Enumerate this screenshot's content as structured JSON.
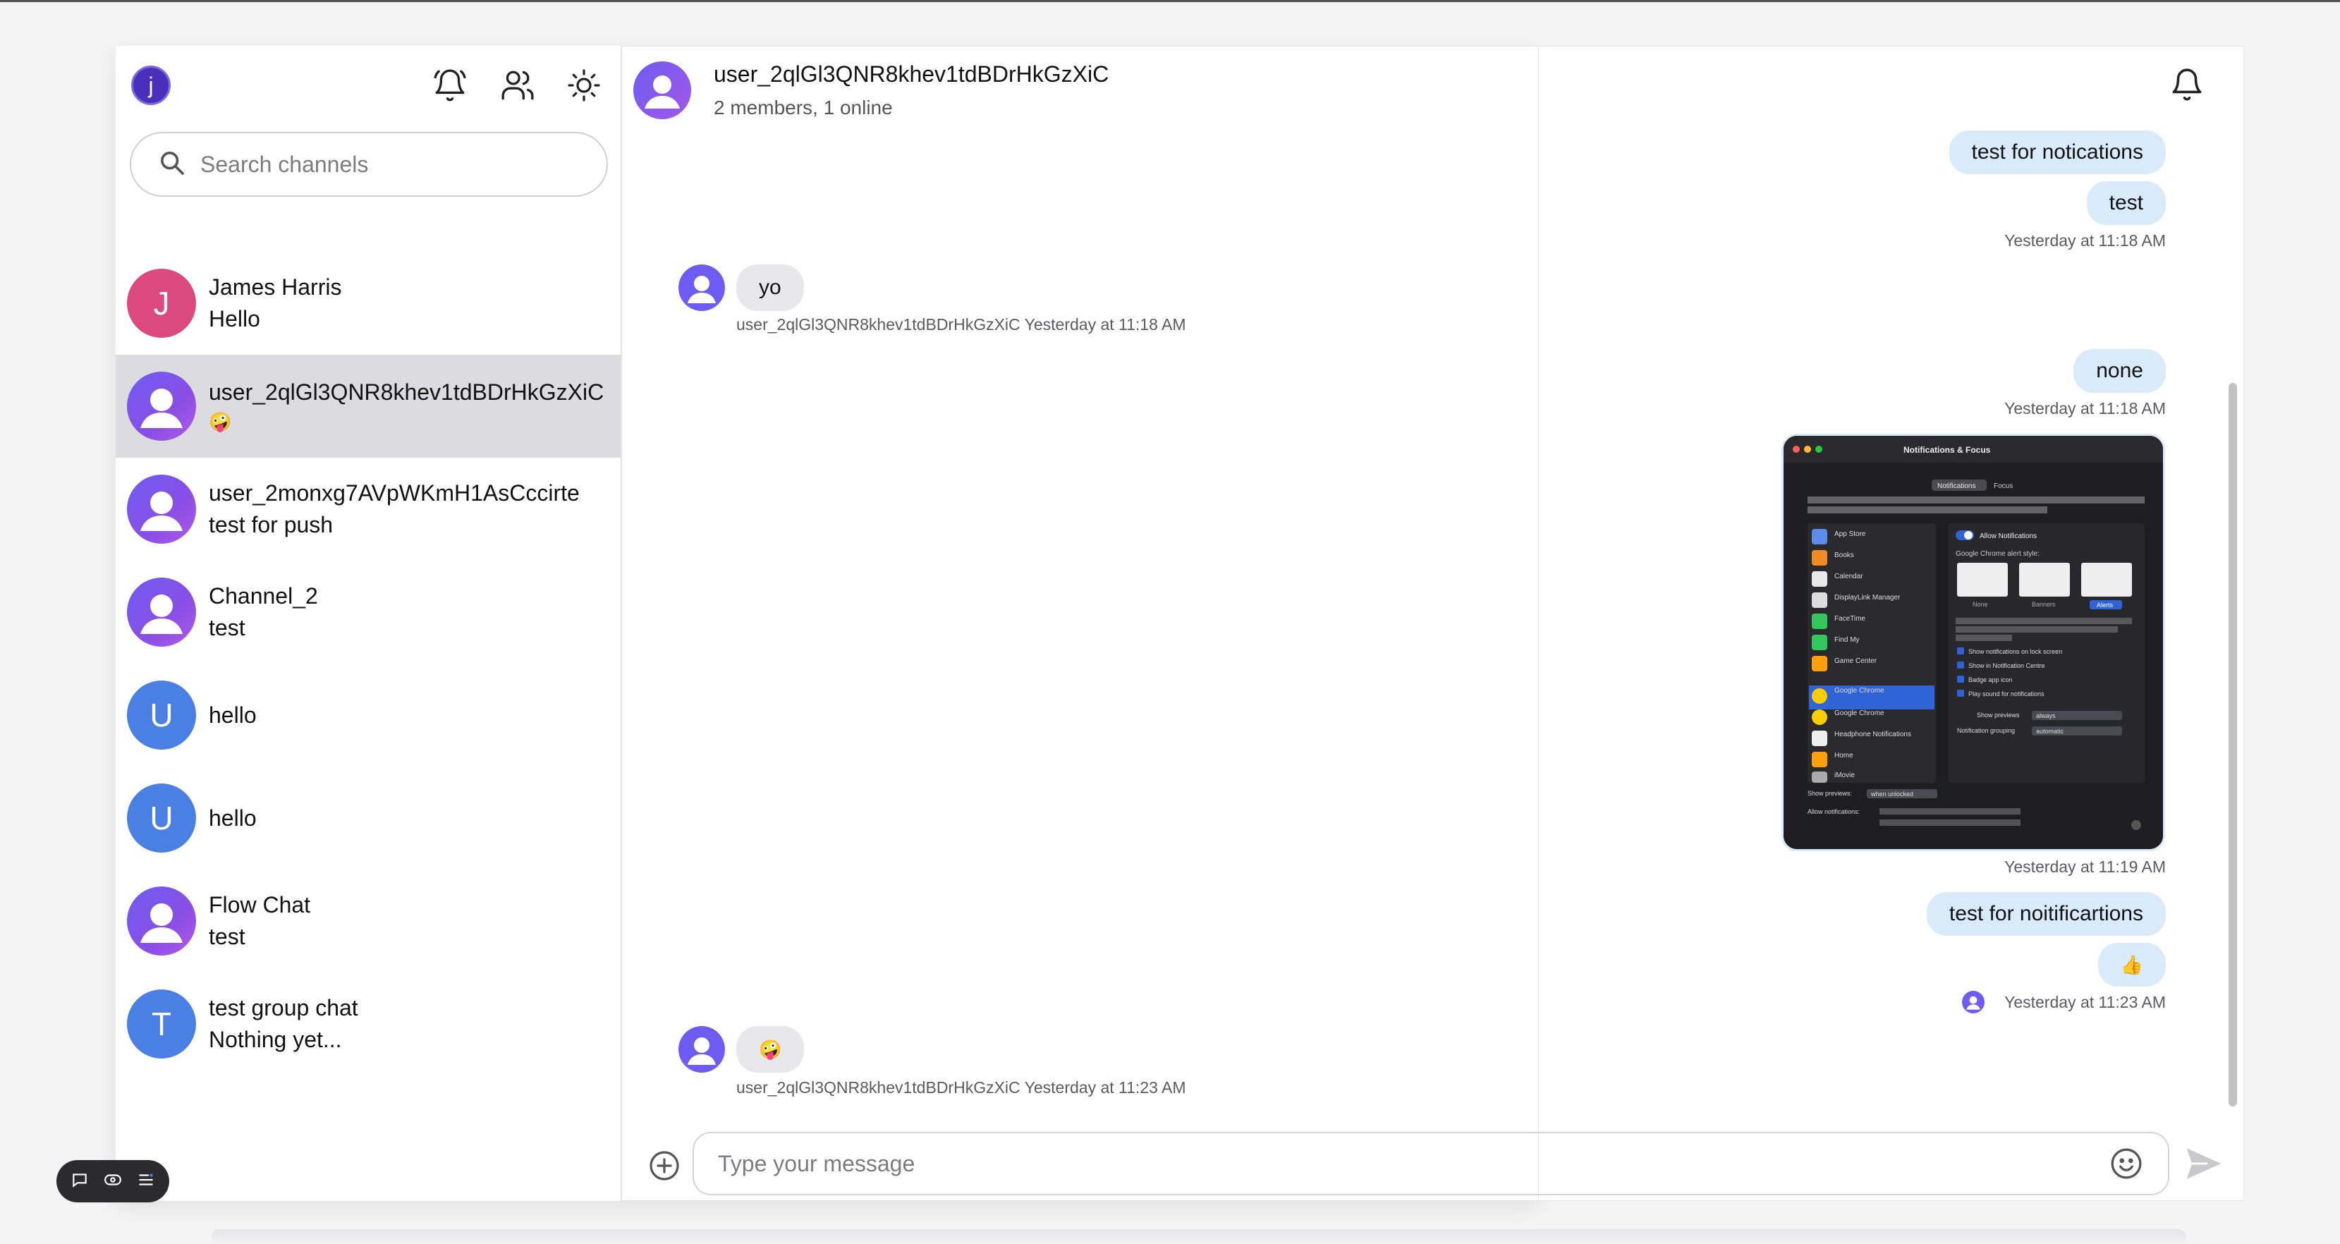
{
  "me": {
    "initial": "j"
  },
  "search": {
    "placeholder": "Search channels"
  },
  "channels": [
    {
      "name": "James Harris",
      "preview": "Hello",
      "avatar_initial": "J"
    },
    {
      "name": "user_2qlGl3QNR8khev1tdBDrHkGzXiC",
      "preview": "🤪",
      "active": true
    },
    {
      "name": "user_2monxg7AVpWKmH1AsCccirte",
      "preview": "test for push"
    },
    {
      "name": "Channel_2",
      "preview": "test"
    },
    {
      "name": "",
      "preview": "hello",
      "avatar_initial": "U"
    },
    {
      "name": "",
      "preview": "hello",
      "avatar_initial": "U"
    },
    {
      "name": "Flow Chat",
      "preview": "test"
    },
    {
      "name": "test group chat",
      "preview": "Nothing yet...",
      "avatar_initial": "T"
    }
  ],
  "header": {
    "title": "user_2qlGl3QNR8khev1tdBDrHkGzXiC",
    "subtitle": "2 members, 1 online"
  },
  "messages": {
    "out1": "test for notications",
    "out2": "test",
    "out_time1": "Yesterday at 11:18 AM",
    "in1": "yo",
    "in1_meta": "user_2qlGl3QNR8khev1tdBDrHkGzXiC Yesterday at 11:18 AM",
    "out3": "none",
    "out_time2": "Yesterday at 11:18 AM",
    "img_time": "Yesterday at 11:19 AM",
    "out4": "test for noitificartions",
    "out5": "👍",
    "out_time3": "Yesterday at 11:23 AM",
    "in2": "🤪",
    "in2_meta": "user_2qlGl3QNR8khev1tdBDrHkGzXiC Yesterday at 11:23 AM"
  },
  "attachment": {
    "window_title": "Notifications & Focus",
    "tab_notifications": "Notifications",
    "tab_focus": "Focus",
    "description": "Notification Centre shows your alerts in the upper right of your screen, without interrupting what you're doing. Show and hide Notification Centre by clicking the clock in the menu bar.",
    "apps": [
      "App Store",
      "Books",
      "Calendar",
      "DisplayLink Manager",
      "FaceTime",
      "Find My",
      "Game Center",
      "Google Chrome",
      "Google Chrome",
      "Headphone Notifications",
      "Home",
      "iMovie"
    ],
    "allow_label": "Allow Notifications",
    "alert_style_label": "Google Chrome alert style:",
    "styles": [
      "None",
      "Banners",
      "Alerts"
    ],
    "options": [
      "Show notifications on lock screen",
      "Show in Notification Centre",
      "Badge app icon",
      "Play sound for notifications"
    ],
    "show_previews_label": "Show previews",
    "show_previews_value": "always",
    "grouping_label": "Notification grouping",
    "grouping_value": "automatic",
    "footer_previews": "Show previews:",
    "footer_previews_value": "when unlocked",
    "footer_allow": "Allow notifications:"
  },
  "composer": {
    "placeholder": "Type your message"
  },
  "colors": {
    "accent": "#4a7fe3",
    "outgoing_bubble": "#d9ebfb",
    "incoming_bubble": "#e8e8eb",
    "active_channel": "#dcdce0"
  }
}
